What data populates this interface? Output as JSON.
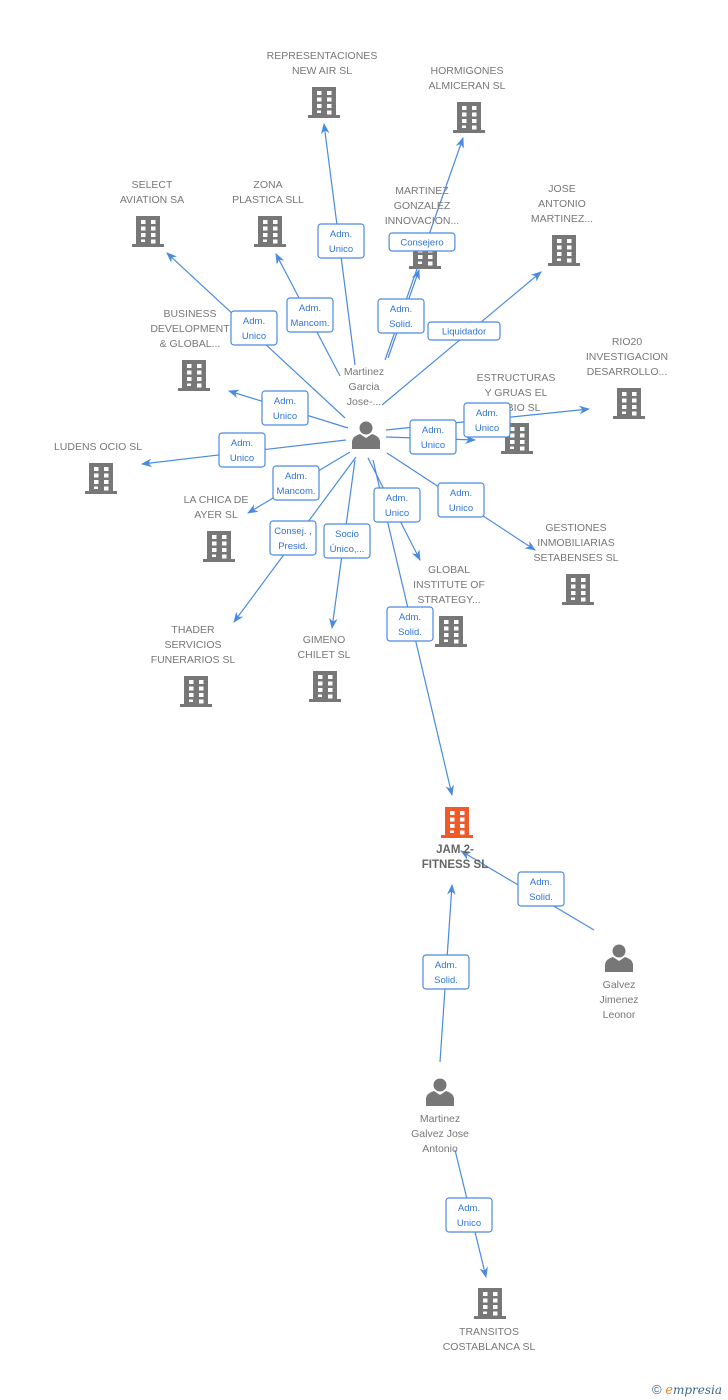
{
  "colors": {
    "edge": "#4a8be0",
    "company": "#777777",
    "focus_company": "#f05a28",
    "person": "#777777"
  },
  "nodes": [
    {
      "id": "mgj",
      "type": "person",
      "lines": [
        "Martinez",
        "Garcia",
        "Jose-..."
      ]
    },
    {
      "id": "repr",
      "type": "company",
      "lines": [
        "REPRESENTACIONES",
        "NEW AIR SL"
      ]
    },
    {
      "id": "horm",
      "type": "company",
      "lines": [
        "HORMIGONES",
        "ALMICERAN  SL"
      ]
    },
    {
      "id": "select",
      "type": "company",
      "lines": [
        "SELECT",
        "AVIATION SA"
      ]
    },
    {
      "id": "zona",
      "type": "company",
      "lines": [
        "ZONA",
        "PLASTICA SLL"
      ]
    },
    {
      "id": "mgi",
      "type": "company",
      "lines": [
        "MARTINEZ",
        "GONZALEZ",
        "INNOVACION..."
      ]
    },
    {
      "id": "jam_jose",
      "type": "company",
      "lines": [
        "JOSE",
        "ANTONIO",
        "MARTINEZ..."
      ]
    },
    {
      "id": "business",
      "type": "company",
      "lines": [
        "BUSINESS",
        "DEVELOPMENT",
        "& GLOBAL..."
      ]
    },
    {
      "id": "rio20",
      "type": "company",
      "lines": [
        "RIO20",
        "INVESTIGACION",
        "DESARROLLO..."
      ]
    },
    {
      "id": "estruct",
      "type": "company",
      "lines": [
        "ESTRUCTURAS",
        "Y GRUAS EL",
        "RUBIO SL"
      ]
    },
    {
      "id": "ludens",
      "type": "company",
      "lines": [
        "LUDENS OCIO SL"
      ]
    },
    {
      "id": "lachica",
      "type": "company",
      "lines": [
        "LA CHICA DE",
        "AYER SL"
      ]
    },
    {
      "id": "gestiones",
      "type": "company",
      "lines": [
        "GESTIONES",
        "INMOBILIARIAS",
        "SETABENSES SL"
      ]
    },
    {
      "id": "global",
      "type": "company",
      "lines": [
        "GLOBAL",
        "INSTITUTE OF",
        "STRATEGY..."
      ]
    },
    {
      "id": "thader",
      "type": "company",
      "lines": [
        "THADER",
        "SERVICIOS",
        "FUNERARIOS SL"
      ]
    },
    {
      "id": "gimeno",
      "type": "company",
      "lines": [
        "GIMENO",
        "CHILET SL"
      ]
    },
    {
      "id": "jam2",
      "type": "focus_company",
      "lines": [
        "JAM 2-",
        "FITNESS SL"
      ]
    },
    {
      "id": "galvez",
      "type": "person",
      "lines": [
        "Galvez",
        "Jimenez",
        "Leonor"
      ]
    },
    {
      "id": "mgja",
      "type": "person",
      "lines": [
        "Martinez",
        "Galvez Jose",
        "Antonio"
      ]
    },
    {
      "id": "transitos",
      "type": "company",
      "lines": [
        "TRANSITOS",
        "COSTABLANCA SL"
      ]
    }
  ],
  "edges": [
    {
      "from": "mgj",
      "to": "repr",
      "role": [
        "Adm.",
        "Unico"
      ]
    },
    {
      "from": "mgj",
      "to": "horm",
      "role": [
        "Consejero"
      ]
    },
    {
      "from": "mgj",
      "to": "mgi",
      "role": [
        "Adm.",
        "Solid."
      ]
    },
    {
      "from": "mgj",
      "to": "select",
      "role": [
        "Adm.",
        "Unico"
      ]
    },
    {
      "from": "mgj",
      "to": "zona",
      "role": [
        "Adm.",
        "Mancom."
      ]
    },
    {
      "from": "mgj",
      "to": "jam_jose",
      "role": [
        "Liquidador"
      ]
    },
    {
      "from": "mgj",
      "to": "business",
      "role": [
        "Adm.",
        "Unico"
      ]
    },
    {
      "from": "mgj",
      "to": "ludens",
      "role": [
        "Adm.",
        "Unico"
      ]
    },
    {
      "from": "mgj",
      "to": "lachica",
      "role": [
        "Adm.",
        "Mancom."
      ]
    },
    {
      "from": "mgj",
      "to": "thader",
      "role": [
        "Consej. ,",
        "Presid."
      ]
    },
    {
      "from": "mgj",
      "to": "gimeno",
      "role": [
        "Socio",
        "Único,..."
      ]
    },
    {
      "from": "mgj",
      "to": "global",
      "role": [
        "Adm.",
        "Unico"
      ]
    },
    {
      "from": "mgj",
      "to": "jam2",
      "role": [
        "Adm.",
        "Solid."
      ]
    },
    {
      "from": "mgj",
      "to": "gestiones",
      "role": [
        "Adm.",
        "Unico"
      ]
    },
    {
      "from": "mgj",
      "to": "estruct",
      "role": [
        "Adm.",
        "Unico"
      ]
    },
    {
      "from": "mgj",
      "to": "rio20",
      "role": [
        "Adm.",
        "Unico"
      ]
    },
    {
      "from": "galvez",
      "to": "jam2",
      "role": [
        "Adm.",
        "Solid."
      ]
    },
    {
      "from": "mgja",
      "to": "jam2",
      "role": [
        "Adm.",
        "Solid."
      ]
    },
    {
      "from": "mgja",
      "to": "transitos",
      "role": [
        "Adm.",
        "Unico"
      ]
    }
  ],
  "footer": {
    "copyright": "©",
    "brand_initial": "e",
    "brand_rest": "mpresia"
  }
}
